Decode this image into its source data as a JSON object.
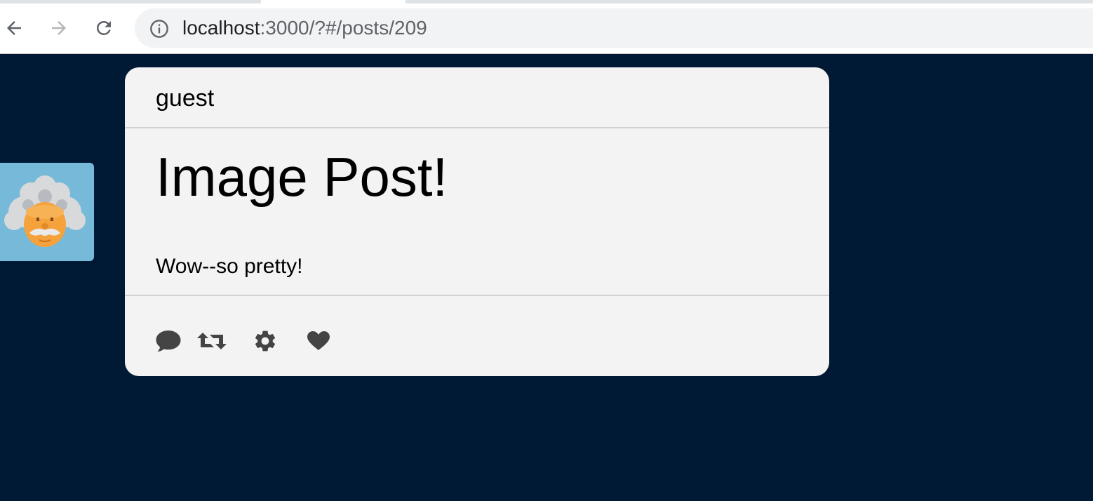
{
  "browser": {
    "url_host": "localhost",
    "url_rest": ":3000/?#/posts/209",
    "icons": {
      "back": "arrow-left-icon",
      "forward": "arrow-right-icon",
      "reload": "reload-icon",
      "info": "info-icon"
    }
  },
  "post": {
    "username": "guest",
    "title": "Image Post!",
    "body": "Wow--so pretty!",
    "avatar": "einstein-avatar",
    "actions": [
      "comment-icon",
      "retweet-icon",
      "gear-icon",
      "heart-icon"
    ]
  },
  "colors": {
    "page_background": "#001a35",
    "card_background": "#f3f3f4",
    "avatar_background": "#76b9d9",
    "icon_color": "#444444"
  }
}
